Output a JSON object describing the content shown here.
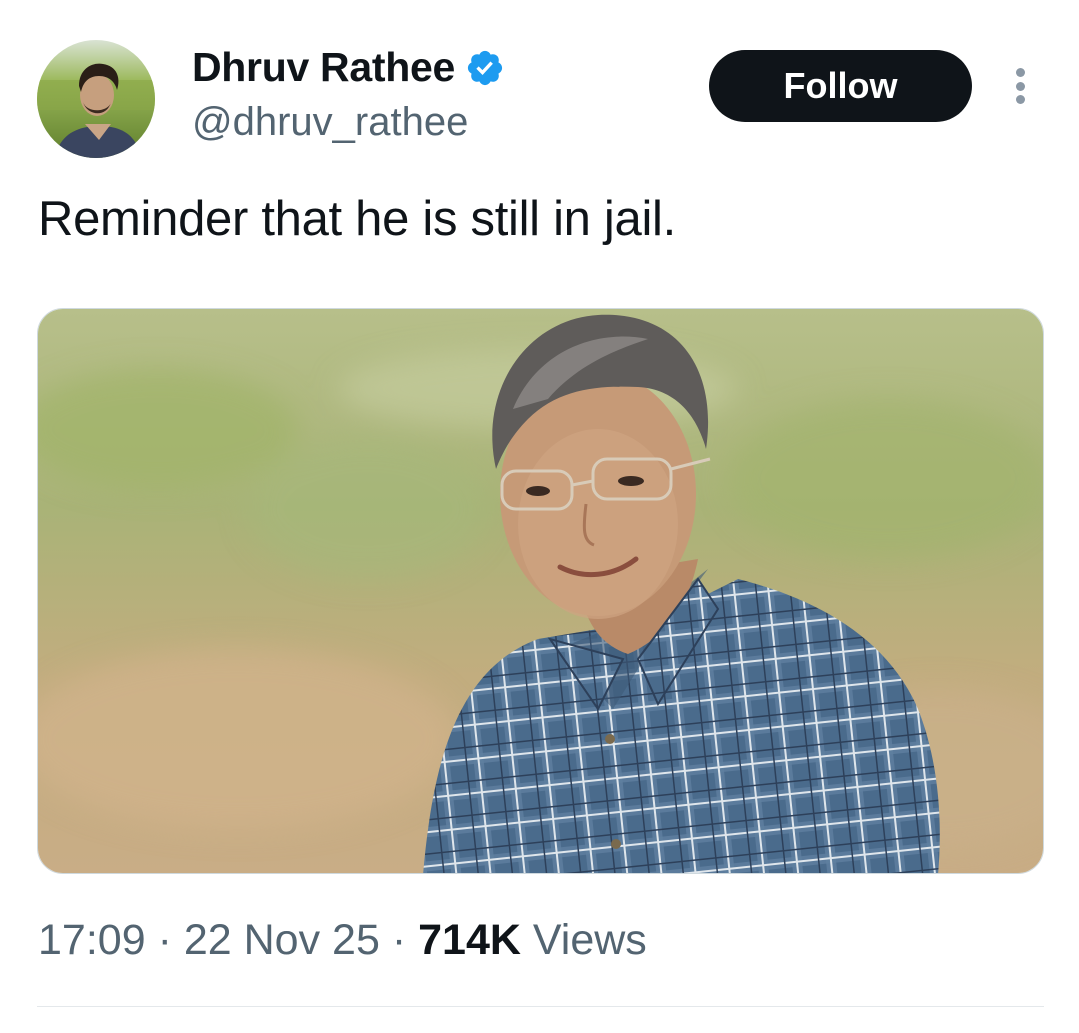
{
  "author": {
    "display_name": "Dhruv Rathee",
    "handle": "@dhruv_rathee",
    "verified": true
  },
  "actions": {
    "follow_label": "Follow"
  },
  "tweet": {
    "text": "Reminder that he is still in jail.",
    "time": "17:09",
    "date": "22 Nov 25",
    "views_count": "714K",
    "views_label": "Views",
    "separator": "·"
  },
  "colors": {
    "text_primary": "#0f1419",
    "text_secondary": "#536471",
    "verified_blue": "#1d9bf0",
    "follow_bg": "#0f1419"
  },
  "icons": {
    "verified": "verified-badge-icon",
    "more": "more-options-icon"
  }
}
